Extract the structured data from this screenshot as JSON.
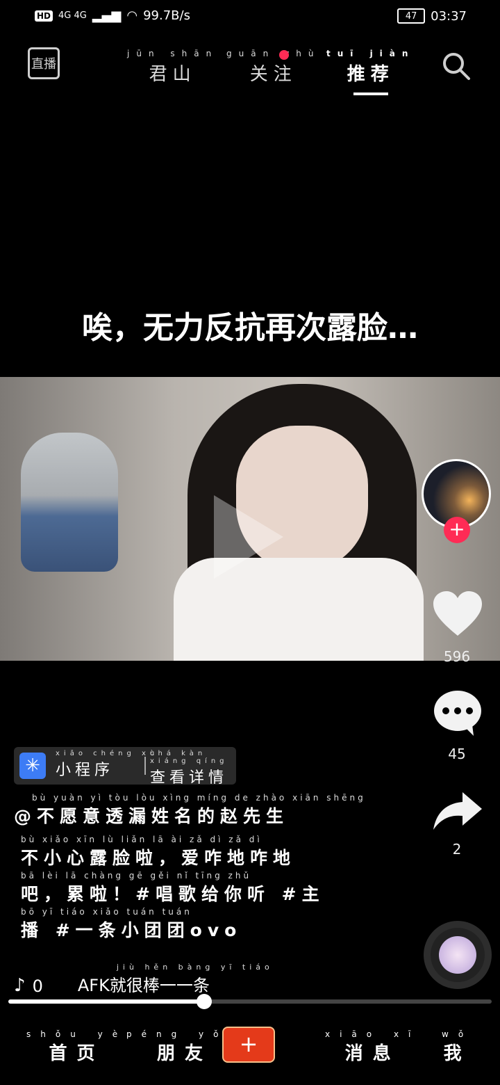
{
  "status_bar": {
    "hd": "HD",
    "network": "4G 4G",
    "speed": "99.7B/s",
    "battery": "47",
    "time": "03:37"
  },
  "top_nav": {
    "live_label": "直播",
    "tabs": [
      {
        "pinyin": "jūn shān",
        "label": "君山"
      },
      {
        "pinyin": "guān zhù",
        "label": "关注"
      },
      {
        "pinyin": "tuī jiàn",
        "label": "推荐"
      }
    ],
    "active_tab": "推荐",
    "search_icon": "search-icon"
  },
  "overlay_text": "唉，无力反抗再次露脸…",
  "side_actions": {
    "likes": "596",
    "comments": "45",
    "shares": "2"
  },
  "mini_program": {
    "pinyin1": "xiǎo chéng xù",
    "label1": "小程序",
    "pinyin2": "chá kàn xiáng qíng",
    "label2": "查看详情"
  },
  "caption": {
    "handle_pinyin": "bù yuàn yì tòu lòu xìng míng de zhào xiān shēng",
    "handle": "@不愿意透漏姓名的赵先生",
    "line1_pinyin": "bù xiǎo xīn lù liǎn lā ài zǎ dì zǎ dì",
    "line1": "不小心露脸啦，爱咋地咋地",
    "line2_pinyin": "bā lèi lā chàng gē gěi nǐ tīng zhǔ",
    "line2": "吧，累啦！#唱歌给你听 #主",
    "line3_pinyin": "bō yī tiáo xiǎo tuán tuán",
    "line3": "播 #一条小团团ovo"
  },
  "music": {
    "note_icon": "music-note-icon",
    "count": "0",
    "song_pinyin": "jiù hěn bàng yī tiáo",
    "song": "AFK就很棒一一条"
  },
  "progress": {
    "fraction": 0.405
  },
  "bottom_nav": [
    {
      "pinyin": "shǒu yè",
      "label": "首页"
    },
    {
      "pinyin": "péng yǒu",
      "label": "朋友"
    },
    {
      "pinyin": "",
      "label": "+"
    },
    {
      "pinyin": "xiāo xī",
      "label": "消息"
    },
    {
      "pinyin": "wǒ",
      "label": "我"
    }
  ]
}
